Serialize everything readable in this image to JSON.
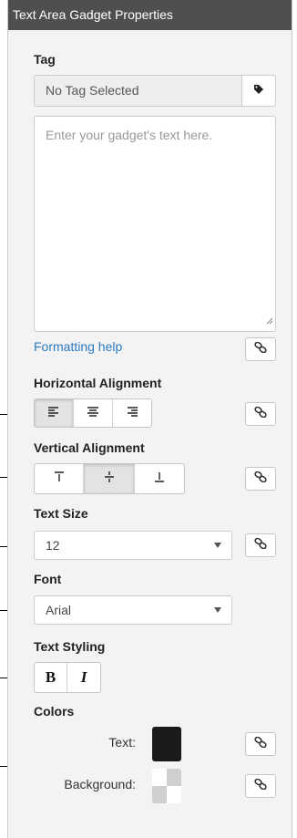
{
  "title": "Text Area Gadget Properties",
  "tag": {
    "label": "Tag",
    "value": "No Tag Selected",
    "tag_button_icon": "tag-icon"
  },
  "textarea": {
    "placeholder": "Enter your gadget's text here."
  },
  "formatting_help": {
    "label": "Formatting help",
    "link_color": "#2a7bc1"
  },
  "link_button_icon": "chain-link-icon",
  "horizontal_alignment": {
    "label": "Horizontal Alignment",
    "options": [
      "align-left",
      "align-center",
      "align-right"
    ],
    "selected": "align-left"
  },
  "vertical_alignment": {
    "label": "Vertical Alignment",
    "options": [
      "align-top",
      "align-middle",
      "align-bottom"
    ],
    "selected": "align-middle"
  },
  "text_size": {
    "label": "Text Size",
    "value": "12"
  },
  "font": {
    "label": "Font",
    "value": "Arial"
  },
  "text_styling": {
    "label": "Text Styling",
    "bold": "B",
    "italic": "I"
  },
  "colors": {
    "label": "Colors",
    "text_label": "Text:",
    "text_color": "#1a1a1a",
    "background_label": "Background:",
    "background_color": "transparent"
  },
  "theme": {
    "titlebar_bg": "#4f4f4f",
    "panel_bg": "#f3f3f3"
  }
}
